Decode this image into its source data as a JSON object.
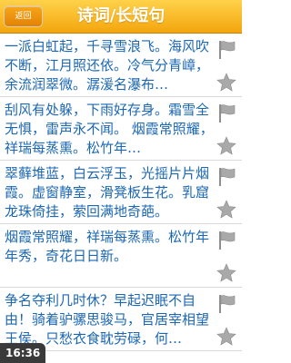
{
  "header": {
    "back_label": "返回",
    "title": "诗词/长短句"
  },
  "items": [
    {
      "text": "一派白虹起，千寻雪浪飞。海风吹不断，江月照还依。冷气分青嶂，余流润翠微。潺湲名瀑布…"
    },
    {
      "text": "刮风有处躲，下雨好存身。霜雪全无惧，雷声永不闻。  烟霞常照耀，祥瑞每蒸熏。松竹年…"
    },
    {
      "text": "翠藓堆蓝，白云浮玉，光摇片片烟霞。虚窗静室，滑凳板生花。乳窟龙珠倚挂，萦回满地奇葩。"
    },
    {
      "text": "烟霞常照耀，祥瑞每蒸熏。松竹年年秀，奇花日日新。"
    },
    {
      "text": "争名夺利几时休？早起迟眠不自由！骑着驴骡思骏马，官居宰相望王侯。只愁衣食耽劳碌，何…"
    }
  ],
  "status": {
    "time": "16:36"
  },
  "colors": {
    "header_top": "#ffd24a",
    "header_bottom": "#f3a50d",
    "text": "#1b67b3",
    "icon_gray": "#a9a9a9"
  }
}
